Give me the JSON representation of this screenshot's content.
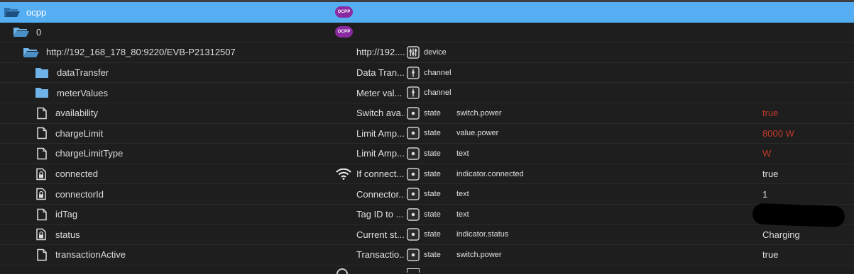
{
  "colors": {
    "selection": "#56aef2",
    "folder": "#6fb3e8",
    "value_red": "#c0392b"
  },
  "rows": [
    {
      "id": "ocpp",
      "name": "ocpp",
      "icon": "folder-open-icon",
      "logo": "OCPP"
    },
    {
      "id": "instance",
      "name": "0",
      "icon": "folder-open-icon",
      "logo": "OCPP"
    },
    {
      "id": "device",
      "name": "http://192_168_178_80:9220/EVB-P21312507",
      "icon": "folder-open-icon",
      "display_name": "http://192....",
      "type": "device",
      "type_icon": "device-icon"
    },
    {
      "id": "dataTransfer",
      "name": "dataTransfer",
      "icon": "folder-icon",
      "display_name": "Data Tran...",
      "type": "channel",
      "type_icon": "channel-icon"
    },
    {
      "id": "meterValues",
      "name": "meterValues",
      "icon": "folder-icon",
      "display_name": "Meter val...",
      "type": "channel",
      "type_icon": "channel-icon"
    },
    {
      "id": "availability",
      "name": "availability",
      "icon": "file-icon",
      "display_name": "Switch ava...",
      "type": "state",
      "type_icon": "state-icon",
      "role": "switch.power",
      "value": "true"
    },
    {
      "id": "chargeLimit",
      "name": "chargeLimit",
      "icon": "file-icon",
      "display_name": "Limit Amp...",
      "type": "state",
      "type_icon": "state-icon",
      "role": "value.power",
      "value": "8000 W"
    },
    {
      "id": "chargeLimitType",
      "name": "chargeLimitType",
      "icon": "file-icon",
      "display_name": "Limit Amp...",
      "type": "state",
      "type_icon": "state-icon",
      "role": "text",
      "value": "W"
    },
    {
      "id": "connected",
      "name": "connected",
      "icon": "file-lock-icon",
      "display_name": "If connect...",
      "type": "state",
      "type_icon": "state-icon",
      "role": "indicator.connected",
      "value": "true",
      "extra_icon": "wifi-icon"
    },
    {
      "id": "connectorId",
      "name": "connectorId",
      "icon": "file-lock-icon",
      "display_name": "Connector...",
      "type": "state",
      "type_icon": "state-icon",
      "role": "text",
      "value": "1"
    },
    {
      "id": "idTag",
      "name": "idTag",
      "icon": "file-icon",
      "display_name": "Tag ID to ...",
      "type": "state",
      "type_icon": "state-icon",
      "role": "text",
      "value": ""
    },
    {
      "id": "status",
      "name": "status",
      "icon": "file-lock-icon",
      "display_name": "Current st...",
      "type": "state",
      "type_icon": "state-icon",
      "role": "indicator.status",
      "value": "Charging"
    },
    {
      "id": "transactionActive",
      "name": "transactionActive",
      "icon": "file-icon",
      "display_name": "Transactio...",
      "type": "state",
      "type_icon": "state-icon",
      "role": "switch.power",
      "value": "true"
    }
  ]
}
